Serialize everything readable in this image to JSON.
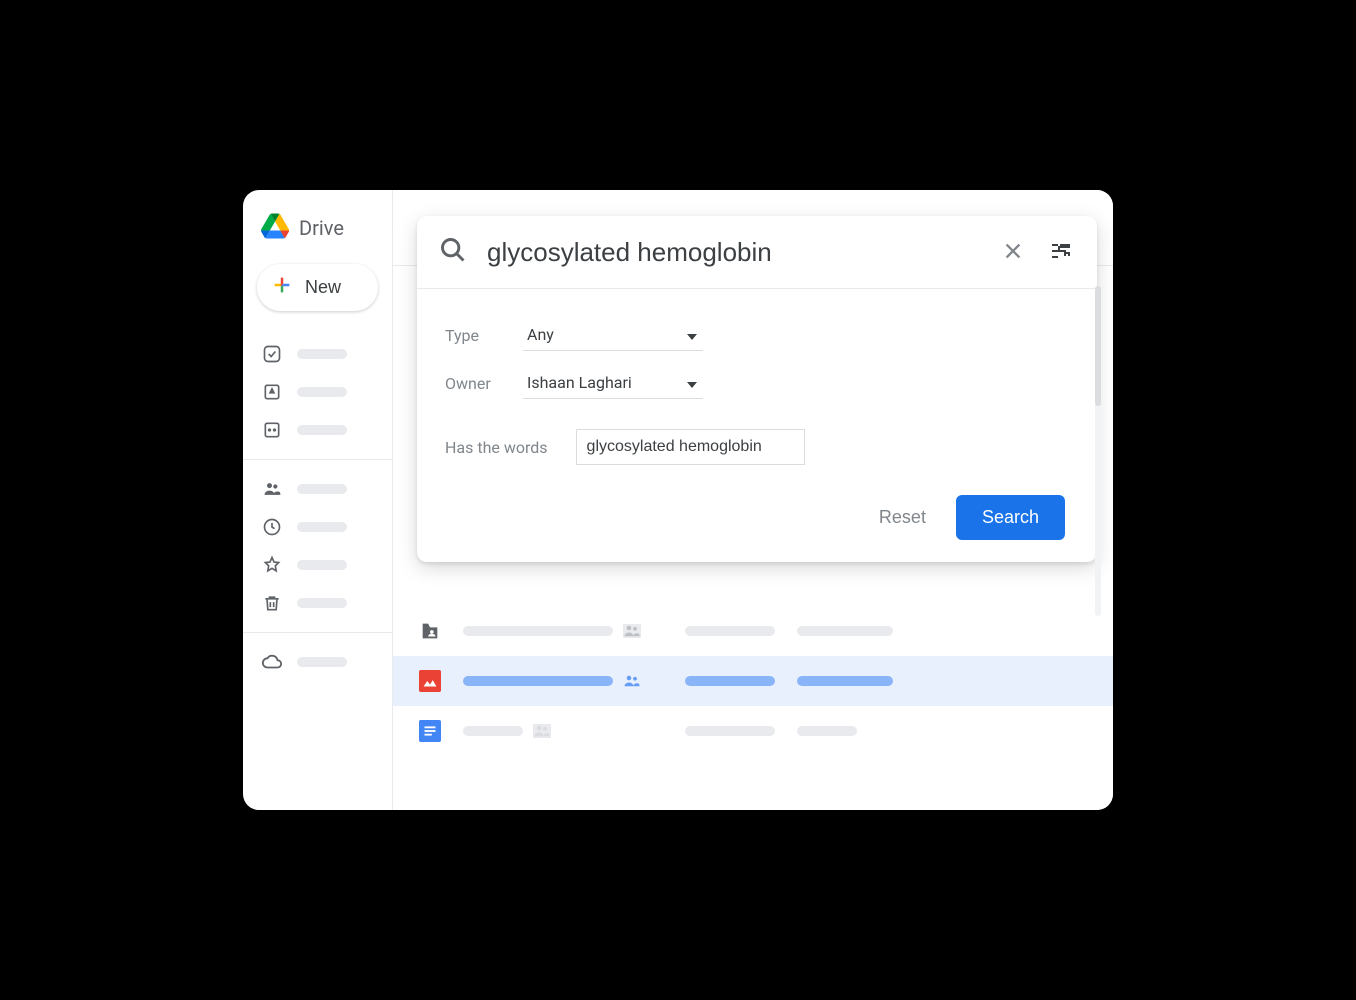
{
  "brand": {
    "name": "Drive"
  },
  "sidebar": {
    "new_label": "New"
  },
  "search": {
    "query": "glycosylated hemoglobin",
    "filters": {
      "type_label": "Type",
      "type_value": "Any",
      "owner_label": "Owner",
      "owner_value": "Ishaan Laghari",
      "words_label": "Has the words",
      "words_value": "glycosylated hemoglobin"
    },
    "reset_label": "Reset",
    "search_label": "Search"
  }
}
